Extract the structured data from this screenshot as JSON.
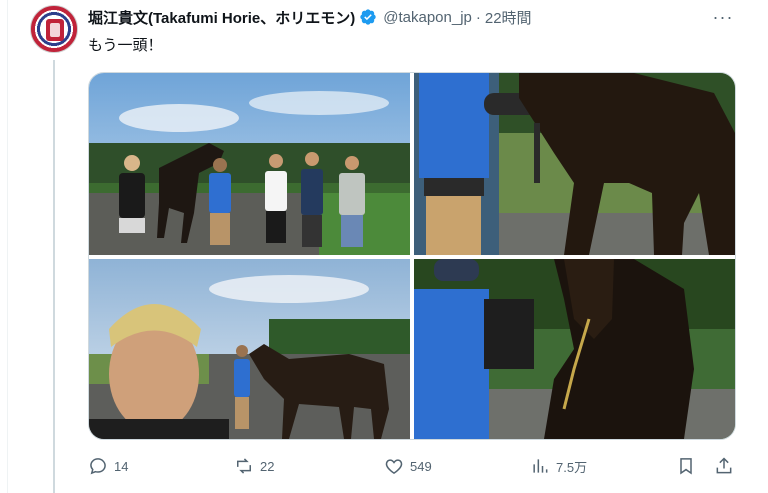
{
  "tweet": {
    "author_name": "堀江貴文(Takafumi Horie、ホリエモン)",
    "handle": "@takapon_jp",
    "separator": "·",
    "time": "22時間",
    "more_label": "···",
    "text": "もう一頭！"
  },
  "media": {
    "photos": [
      {
        "icon": "photo-group-with-horse"
      },
      {
        "icon": "photo-handler-with-horse"
      },
      {
        "icon": "photo-selfie-with-foal"
      },
      {
        "icon": "photo-horse-head-closeup"
      }
    ]
  },
  "actions": {
    "reply_count": "14",
    "repost_count": "22",
    "like_count": "549",
    "views_count": "7.5万"
  },
  "colors": {
    "text": "#0f1419",
    "secondary": "#536471",
    "verified": "#1d9bf0",
    "border": "#cfd9de"
  }
}
